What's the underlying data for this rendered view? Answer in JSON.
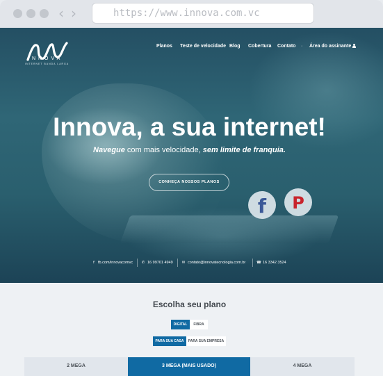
{
  "browser": {
    "url": "https://www.innova.com.vc"
  },
  "site": {
    "logo_word": "INNOVA",
    "logo_tagline": "INTERNET BANDA LARGA",
    "nav": [
      "Planos",
      "Teste de velocidade",
      "Blog",
      "Cobertura",
      "Contato"
    ],
    "nav_separator": "·",
    "subscriber_area": "Área do assinante"
  },
  "hero": {
    "title": "Innova, a sua internet!",
    "subtitle_part1": "Navegue",
    "subtitle_part2": " com mais velocidade, ",
    "subtitle_part3": "sem limite de franquia.",
    "cta_label": "CONHEÇA NOSSOS PLANOS",
    "social_facebook": "f",
    "social_pinterest": "P",
    "contacts": [
      {
        "icon": "facebook-icon",
        "text": "fb.com/innovacomvc"
      },
      {
        "icon": "whatsapp-icon",
        "text": "16 99701 4949"
      },
      {
        "icon": "email-icon",
        "text": "contato@innovatecnologia.com.br"
      },
      {
        "icon": "phone-icon",
        "text": "16 3342 3524"
      }
    ]
  },
  "plans": {
    "title": "Escolha seu plano",
    "tech_toggle": {
      "selected": "DIGITAL",
      "other": "FIBRA"
    },
    "audience_toggle": {
      "selected": "PARA SUA CASA",
      "other": "PARA SUA EMPRESA"
    },
    "tabs": [
      {
        "label": "2 MEGA",
        "active": false
      },
      {
        "label": "3 MEGA (MAIS USADO)",
        "active": true
      },
      {
        "label": "4 MEGA",
        "active": false
      }
    ]
  },
  "colors": {
    "accent": "#106aa3",
    "hero_overlay": "#2a5f6e"
  }
}
